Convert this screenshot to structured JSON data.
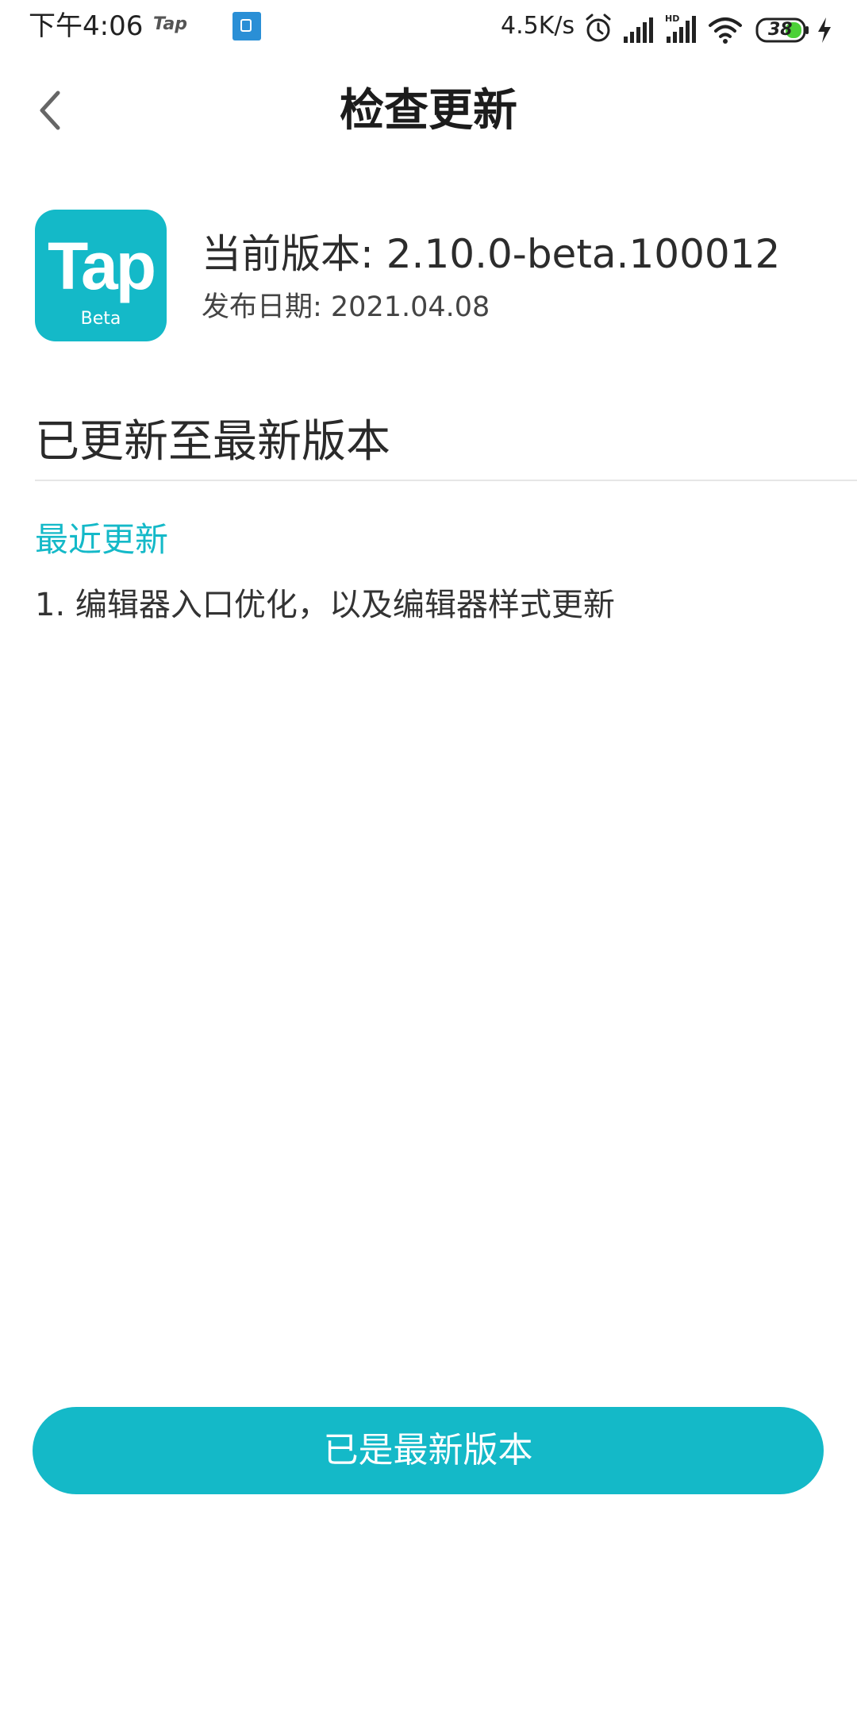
{
  "status_bar": {
    "time": "下午4:06",
    "tap_label": "Tap",
    "net_speed": "4.5K/s",
    "battery": "38",
    "icons": [
      "notification-app-icon",
      "alarm-icon",
      "signal-icon",
      "hd-signal-icon",
      "wifi-icon",
      "battery-icon",
      "charging-icon"
    ]
  },
  "header": {
    "title": "检查更新",
    "back_icon": "chevron-left-icon"
  },
  "app": {
    "logo_text": "Tap",
    "logo_badge": "Beta",
    "current_version": "当前版本: 2.10.0-beta.100012",
    "release_date": "发布日期: 2021.04.08"
  },
  "update": {
    "status": "已更新至最新版本",
    "recent_title": "最近更新",
    "changelog": [
      "1. 编辑器入口优化，以及编辑器样式更新"
    ]
  },
  "action": {
    "button_label": "已是最新版本"
  },
  "colors": {
    "accent": "#14b9c8",
    "text_primary": "#1c1c1c",
    "divider": "#e6e6e6"
  }
}
